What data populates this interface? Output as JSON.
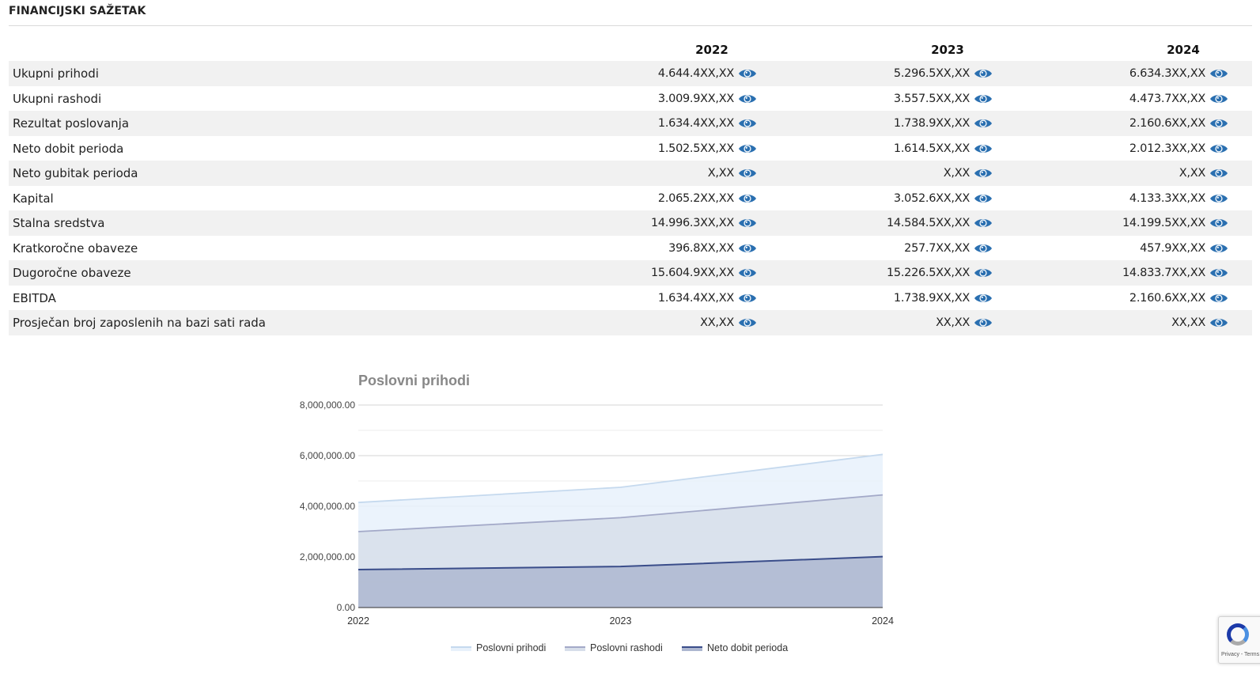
{
  "section": {
    "title": "FINANCIJSKI SAŽETAK"
  },
  "table": {
    "years": [
      "2022",
      "2023",
      "2024"
    ],
    "rows": [
      {
        "label": "Ukupni prihodi",
        "values": [
          "4.644.4XX,XX",
          "5.296.5XX,XX",
          "6.634.3XX,XX"
        ]
      },
      {
        "label": "Ukupni rashodi",
        "values": [
          "3.009.9XX,XX",
          "3.557.5XX,XX",
          "4.473.7XX,XX"
        ]
      },
      {
        "label": "Rezultat poslovanja",
        "values": [
          "1.634.4XX,XX",
          "1.738.9XX,XX",
          "2.160.6XX,XX"
        ]
      },
      {
        "label": "Neto dobit perioda",
        "values": [
          "1.502.5XX,XX",
          "1.614.5XX,XX",
          "2.012.3XX,XX"
        ]
      },
      {
        "label": "Neto gubitak perioda",
        "values": [
          "X,XX",
          "X,XX",
          "X,XX"
        ]
      },
      {
        "label": "Kapital",
        "values": [
          "2.065.2XX,XX",
          "3.052.6XX,XX",
          "4.133.3XX,XX"
        ]
      },
      {
        "label": "Stalna sredstva",
        "values": [
          "14.996.3XX,XX",
          "14.584.5XX,XX",
          "14.199.5XX,XX"
        ]
      },
      {
        "label": "Kratkoročne obaveze",
        "values": [
          "396.8XX,XX",
          "257.7XX,XX",
          "457.9XX,XX"
        ]
      },
      {
        "label": "Dugoročne obaveze",
        "values": [
          "15.604.9XX,XX",
          "15.226.5XX,XX",
          "14.833.7XX,XX"
        ]
      },
      {
        "label": "EBITDA",
        "values": [
          "1.634.4XX,XX",
          "1.738.9XX,XX",
          "2.160.6XX,XX"
        ]
      },
      {
        "label": "Prosječan broj zaposlenih na bazi sati rada",
        "values": [
          "XX,XX",
          "XX,XX",
          "XX,XX"
        ]
      }
    ],
    "eye_icon": "eye-icon",
    "eye_color": "#2a6fb0"
  },
  "recaptcha": {
    "privacy": "Privacy - Terms"
  },
  "chart_data": {
    "type": "area",
    "title": "Poslovni prihodi",
    "x": [
      "2022",
      "2023",
      "2024"
    ],
    "y_ticks": [
      "0.00",
      "2,000,000.00",
      "4,000,000.00",
      "6,000,000.00",
      "8,000,000.00"
    ],
    "ylim": [
      0,
      8000000
    ],
    "grid": true,
    "legend": "bottom",
    "series": [
      {
        "name": "Poslovni prihodi",
        "values": [
          4150000,
          4750000,
          6050000
        ],
        "fill": "#e8f1fb",
        "stroke": "#c5d9ee"
      },
      {
        "name": "Poslovni rashodi",
        "values": [
          3000000,
          3550000,
          4450000
        ],
        "fill": "#d7deea",
        "stroke": "#a3a9c8"
      },
      {
        "name": "Neto dobit perioda",
        "values": [
          1500000,
          1620000,
          2010000
        ],
        "fill": "#adb7d0",
        "stroke": "#3a4d8a"
      }
    ]
  }
}
